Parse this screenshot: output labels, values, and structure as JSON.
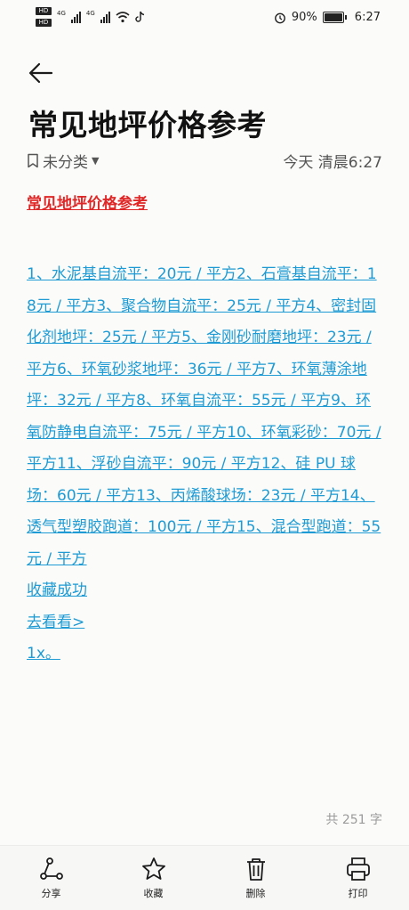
{
  "status": {
    "battery_text": "90%",
    "time": "6:27",
    "network_1": "4G",
    "network_2": "4G",
    "hd": "HD"
  },
  "note": {
    "title": "常见地坪价格参考",
    "category": "未分类",
    "date": "今天 清晨6:27",
    "heading": "常见地坪价格参考",
    "body": "1、水泥基自流平：20元 / 平方2、石膏基自流平：18元 / 平方3、聚合物自流平：25元 / 平方4、密封固化剂地坪：25元 / 平方5、金刚砂耐磨地坪：23元 / 平方6、环氧砂浆地坪：36元 / 平方7、环氧薄涂地坪：32元 / 平方8、环氧自流平：55元 / 平方9、环氧防静电自流平：75元 / 平方10、环氧彩砂：70元 / 平方11、浮砂自流平：90元 / 平方12、硅 PU 球场：60元 / 平方13、丙烯酸球场：23元 / 平方14、透气型塑胶跑道：100元 / 平方15、混合型跑道：55元 / 平方",
    "links": [
      "收藏成功",
      "去看看>",
      "1x。"
    ],
    "word_count": "共 251 字"
  },
  "toolbar": {
    "share": "分享",
    "favorite": "收藏",
    "delete": "删除",
    "print": "打印"
  },
  "colors": {
    "link": "#1e9bd4",
    "heading": "#e02727"
  }
}
